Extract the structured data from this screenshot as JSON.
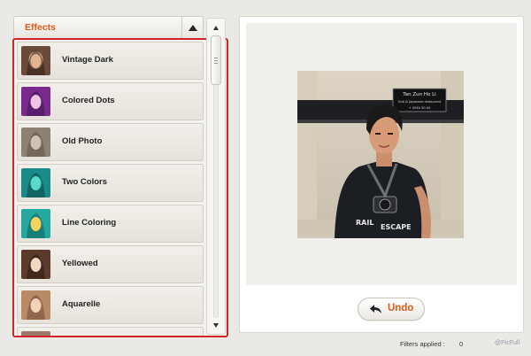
{
  "effects_panel": {
    "title": "Effects",
    "items": [
      {
        "label": "Vintage Dark",
        "thumb_colors": [
          "#6b4a3a",
          "#e0b48f",
          "#2b1d14"
        ]
      },
      {
        "label": "Colored Dots",
        "thumb_colors": [
          "#7a2a8c",
          "#f0c2e4",
          "#3a1550"
        ]
      },
      {
        "label": "Old Photo",
        "thumb_colors": [
          "#8d8172",
          "#cfc4b1",
          "#5e5448"
        ]
      },
      {
        "label": "Two Colors",
        "thumb_colors": [
          "#1b8a8a",
          "#59d9c9",
          "#0d4747"
        ]
      },
      {
        "label": "Line Coloring",
        "thumb_colors": [
          "#24a8a0",
          "#f3d35c",
          "#0f5d59"
        ]
      },
      {
        "label": "Yellowed",
        "thumb_colors": [
          "#5a3b2c",
          "#f0d9c2",
          "#2b1a12"
        ]
      },
      {
        "label": "Aquarelle",
        "thumb_colors": [
          "#b88a66",
          "#f2d3b7",
          "#6e4b34"
        ]
      },
      {
        "label": "",
        "thumb_colors": [
          "#9a7a6a",
          "#d9c2b0",
          "#5e4a3e"
        ]
      }
    ]
  },
  "preview": {
    "undo_label": "Undo"
  },
  "footer": {
    "filters_applied_label": "Filters applied :",
    "filters_applied_count": "0",
    "brand": "@PicFull"
  },
  "photo_sign": {
    "line1": "Tan Zun Ho Li",
    "line2": "Grill & Japanese restaurant",
    "line3": "+ 0040 50 00",
    "shirt_word1": "RAIL",
    "shirt_word2": "ESCAPE"
  },
  "colors": {
    "accent": "#e05a16",
    "highlight_border": "#d2232a"
  },
  "icons": {
    "collapse": "triangle-up-icon",
    "undo": "undo-arrow-icon"
  }
}
